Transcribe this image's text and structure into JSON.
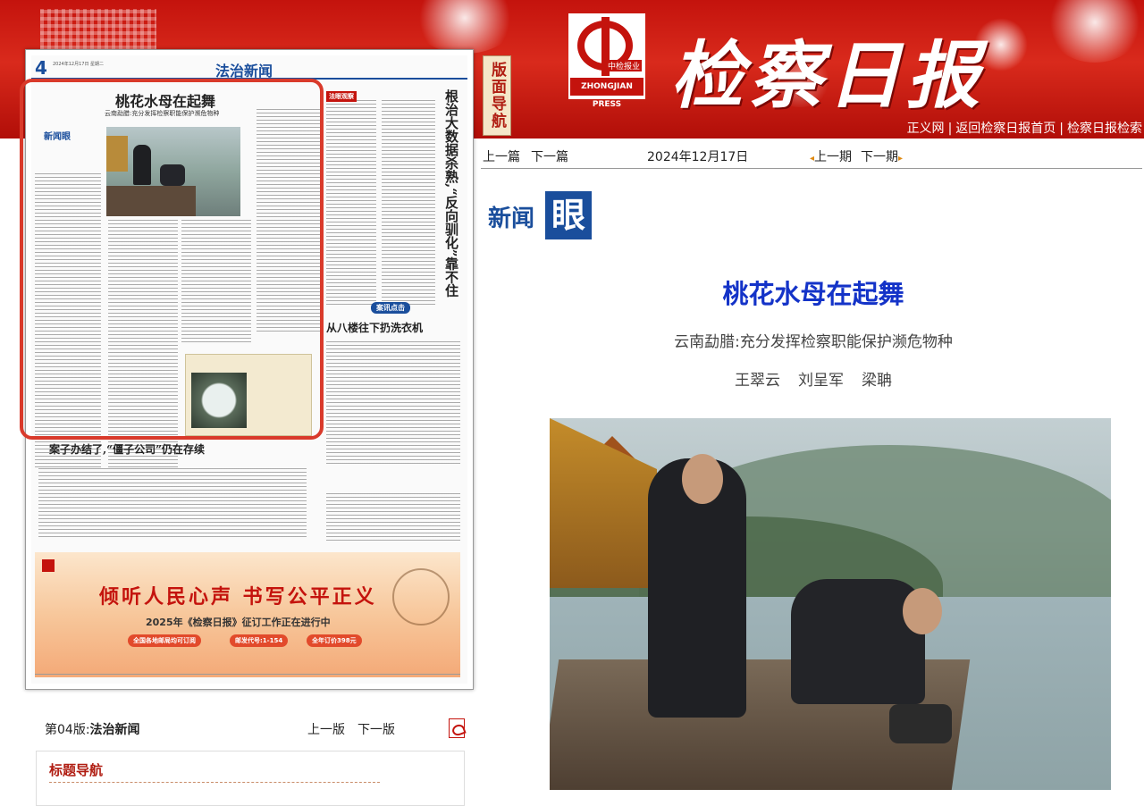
{
  "header": {
    "nav_label": "版面导航",
    "logo_cn": "中检报业",
    "logo_en": "ZHONGJIAN PRESS",
    "masthead": "检察日报",
    "links": [
      "正义网",
      "返回检察日报首页",
      "检察日报检索"
    ]
  },
  "page_preview": {
    "page_num": "4",
    "section": "法治新闻",
    "headline": "桃花水母在起舞",
    "subhead": "云南勐腊:充分发挥检察职能保护濒危物种",
    "column_badge": "新闻眼",
    "headline2": "从八楼往下扔洗衣机",
    "headline3": "案子办结了,“僵子公司”仍在存续",
    "vertical_headline": "根治大数据杀熟,“反向驯化”靠不住",
    "tag_observe": "法眼观察",
    "tag_case": "案讯点击",
    "ad_slogan": "倾听人民心声 书写公平正义",
    "ad_line2": "2025年《检察日报》征订工作正在进行中",
    "ad_pills": [
      "全国各地邮局均可订阅",
      "邮发代号:1-154",
      "全年订价398元"
    ]
  },
  "edition": {
    "label": "第04版:",
    "name": "法治新闻",
    "prev": "上一版",
    "next": "下一版",
    "pdf_icon": "pdf-icon"
  },
  "title_nav": {
    "label": "标题导航"
  },
  "article_nav": {
    "prev": "上一篇",
    "next": "下一篇",
    "date": "2024年12月17日",
    "prev_issue": "上一期",
    "next_issue": "下一期"
  },
  "article": {
    "badge_text": "新闻",
    "badge_box": "眼",
    "title": "桃花水母在起舞",
    "subtitle": "云南勐腊:充分发挥检察职能保护濒危物种",
    "authors": [
      "王翠云",
      "刘呈军",
      "梁聃"
    ]
  },
  "colors": {
    "brand_red": "#c4130d",
    "link_blue": "#1433c8",
    "badge_blue": "#1a4e9c"
  }
}
